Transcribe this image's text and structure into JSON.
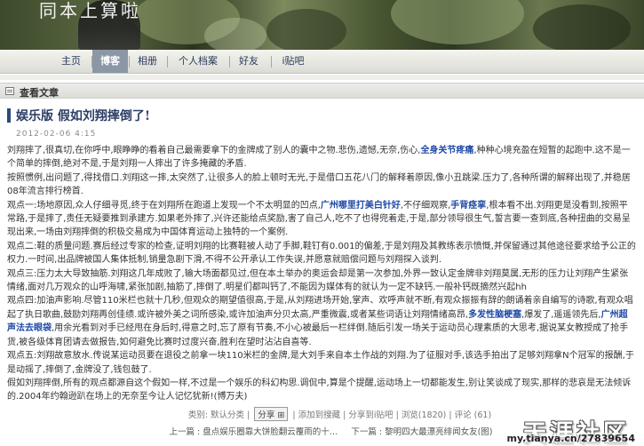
{
  "header": {
    "site_title": "同本上算啦"
  },
  "nav": {
    "items": [
      {
        "label": "主页",
        "active": false
      },
      {
        "label": "博客",
        "active": true
      },
      {
        "label": "相册",
        "active": false
      },
      {
        "label": "个人档案",
        "active": false
      },
      {
        "label": "好友",
        "active": false
      },
      {
        "label": "i贴吧",
        "active": false
      }
    ]
  },
  "section": {
    "title": "查看文章"
  },
  "post": {
    "title": "娱乐版 假如刘翔摔倒了!",
    "date": "2012-02-06 4:15",
    "p1_a": "刘翔摔了,很真切,在你呼中,眼睁睁的看着自己最需要拿下的金牌成了别人的囊中之物.悲伤,遗憾,无奈,伤心,",
    "p1_hl": "全身关节疼痛",
    "p1_b": ",种种心境充盈在短暂的起跑中.这不是一个简单的摔倒,绝对不是,于是刘翔一人摔出了许多掩藏的矛盾.",
    "p2": "按照惯例,出问题了,得找借口.刘翔这一摔,太突然了,让很多人的脸上顿时无光,于是借口五花八门的解释着原因,像小丑跳梁.压力了,各种所谓的解释出现了,并稳居08年流言排行榜首.",
    "p3_a": "观点一:场地原因,众人仔细寻觅,终于在刘翔所在跑道上发现一个不太明显的凹点,",
    "p3_hl1": "广州哪里打美白针好",
    "p3_b": ",不仔细观察,",
    "p3_hl2": "手背痉挛",
    "p3_c": ",根本看不出.刘翔更是没看到,按照平常路,于是摔了,责任无疑要推到承建方.如果老外摔了,兴许还能给点奖励,害了自己人,吃不了也得兜着走,于是,部分领导很生气,誓言要一查到底,各种扭曲的交易呈现出来,一场由刘翔摔倒的积极交易成为中国体育运动上独特的一个案例.",
    "p4": "观点二:鞋的质量问题.赛后经过专家的检查,证明刘翔的比赛鞋被人动了手脚,鞋钉有0.001的偏差,于是刘翔及其教练表示愤慨,并保留通过其他途径要求给予公正的权力.一时间,出品牌被国人集体抵制,销量急剧下滑,不得不公开承认工作失误,并愿意就赔偿问题与刘翔探入谈判.",
    "p5": "观点三:压力太大导致抽筋.刘翔这几年成败了,输大场面都见过,但在本土举办的奥运会却是第一次参加,外界一致认定金牌非刘翔莫属,无形的压力让刘翔产生紧张情绪,面对几万观众的山呼海啸,紧张加剧,抽筋了,摔倒了.明星们都叫钙了,不能因为媒体有的就认为一定不缺钙.一般补钙既摘然兴起hh",
    "p6_a": "观点四:加油声影响.尽管110米栏也就十几秒,但观众的期望值很高,于是,从刘翔进场开始,掌声、欢呼声就不断,有观众振振有辞的朗诵着亲自编写的诗歌,有观众唱起了执日歌曲,鼓励刘翔再创佳绩.或许被外美之词所感染,或许加油声分贝太高,严重微震,或者某些词语让刘翔情绪高昂,",
    "p6_hl1": "多发性脑梗塞",
    "p6_b": ",爆发了,遥遥领先后,",
    "p6_hl2": "广州超声法去眼袋",
    "p6_c": ",用余光看到对手已经甩在身后时,得意之时,忘了原有节奏,不小心被最后一栏绊倒.随后引发一场关于运动员心理素质的大思考,据说某女教授成了抢手货,被各级体育团请去做报告,如何避免比赛时过度兴奋,胜利在望时沾沾自喜等.",
    "p7": "观点五:刘翔故意放水.传说某运动员要在退役之前拿一块110米栏的金牌,是大刘手来自本土作战的刘翔.为了征服对手,该选手拍出了足够刘翔拿N个冠军的报酬,于是动摇了,摔倒了,金牌没了,钱包鼓了.",
    "p8": "假如刘翔摔倒,所有的观点都源自这个假如一样,不过是一个娱乐的科幻构思.调侃中,算是个提醒,运动场上一切都能发生,别让笑谈成了现实,那样的悲哀是无法倾诉的.2004年约翰逊趴在场上的无奈至今让人记忆犹新!(博万夫)"
  },
  "meta": {
    "category_label": "类别:",
    "category_value": "默认分类",
    "share_label": "分享",
    "add_label": "添加到搜藏",
    "share_to_label": "分享到i贴吧",
    "views_label": "浏览(1820)",
    "comments_label": "评论 (61)"
  },
  "pager": {
    "prev": "上一篇 : 盘点娱乐圈靠大饼脸翻云覆雨的十…",
    "next": "下一篇 : 黎明四大最漂亮绯闻女友(图)"
  },
  "watermark": {
    "logo": "天涯社区",
    "url": "my.tianya.cn/27839654"
  }
}
